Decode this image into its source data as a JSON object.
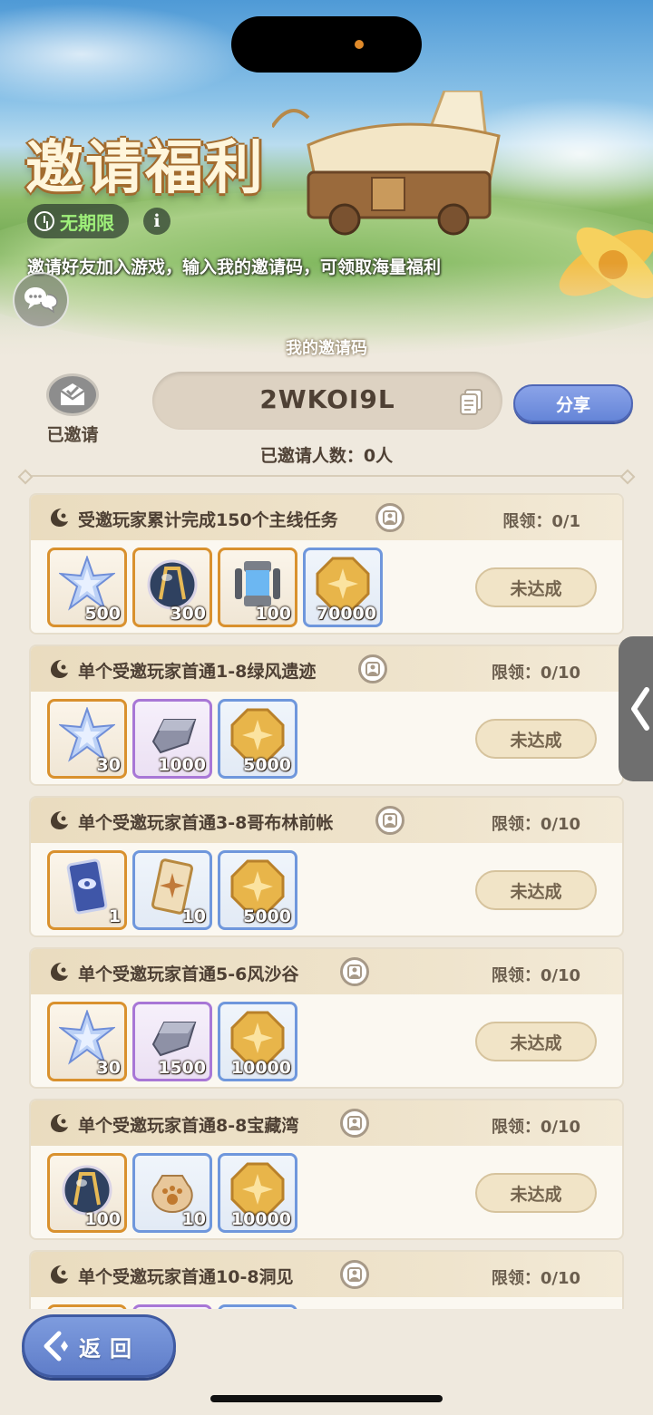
{
  "banner": {
    "title": "邀请福利",
    "period_badge": "无期限",
    "subtitle": "邀请好友加入游戏，输入我的邀请码，可领取海量福利"
  },
  "invite": {
    "heading": "我的邀请码",
    "code": "2WKOI9L",
    "invited_label": "已邀请",
    "share_label": "分享",
    "invited_count": "已邀请人数：0人"
  },
  "tasks": [
    {
      "title": "受邀玩家累计完成150个主线任务",
      "limit": "限领：0/1",
      "status": "未达成",
      "rewards": [
        {
          "icon": "star-crystal-icon",
          "qty": "500",
          "rarity": "orange"
        },
        {
          "icon": "crystal-orb-icon",
          "qty": "300",
          "rarity": "orange"
        },
        {
          "icon": "energy-canister-icon",
          "qty": "100",
          "rarity": "orange"
        },
        {
          "icon": "gold-coin-icon",
          "qty": "70000",
          "rarity": "blue"
        }
      ]
    },
    {
      "title": "单个受邀玩家首通1-8绿风遗迹",
      "limit": "限领：0/10",
      "status": "未达成",
      "rewards": [
        {
          "icon": "star-crystal-icon",
          "qty": "30",
          "rarity": "orange"
        },
        {
          "icon": "iron-ingot-icon",
          "qty": "1000",
          "rarity": "purple"
        },
        {
          "icon": "gold-coin-icon",
          "qty": "5000",
          "rarity": "blue"
        }
      ]
    },
    {
      "title": "单个受邀玩家首通3-8哥布林前帐",
      "limit": "限领：0/10",
      "status": "未达成",
      "rewards": [
        {
          "icon": "blue-card-icon",
          "qty": "1",
          "rarity": "orange"
        },
        {
          "icon": "gold-card-icon",
          "qty": "10",
          "rarity": "blue"
        },
        {
          "icon": "gold-coin-icon",
          "qty": "5000",
          "rarity": "blue"
        }
      ]
    },
    {
      "title": "单个受邀玩家首通5-6风沙谷",
      "limit": "限领：0/10",
      "status": "未达成",
      "rewards": [
        {
          "icon": "star-crystal-icon",
          "qty": "30",
          "rarity": "orange"
        },
        {
          "icon": "iron-ingot-icon",
          "qty": "1500",
          "rarity": "purple"
        },
        {
          "icon": "gold-coin-icon",
          "qty": "10000",
          "rarity": "blue"
        }
      ]
    },
    {
      "title": "单个受邀玩家首通8-8宝藏湾",
      "limit": "限领：0/10",
      "status": "未达成",
      "rewards": [
        {
          "icon": "crystal-orb-icon",
          "qty": "100",
          "rarity": "orange"
        },
        {
          "icon": "paw-bag-icon",
          "qty": "10",
          "rarity": "blue"
        },
        {
          "icon": "gold-coin-icon",
          "qty": "10000",
          "rarity": "blue"
        }
      ]
    },
    {
      "title": "单个受邀玩家首通10-8洞见",
      "limit": "限领：0/10",
      "status": "未达成",
      "rewards": [
        {
          "icon": "star-crystal-icon",
          "qty": "",
          "rarity": "orange"
        },
        {
          "icon": "iron-ingot-icon",
          "qty": "",
          "rarity": "purple"
        },
        {
          "icon": "gold-coin-icon",
          "qty": "",
          "rarity": "blue"
        }
      ]
    }
  ],
  "footer": {
    "back_label": "返回"
  },
  "colors": {
    "accent_blue": "#6585d8",
    "rarity_orange": "#d9912e",
    "rarity_purple": "#a877d6",
    "rarity_blue": "#6f97dc",
    "period_green": "#9ff07a"
  }
}
